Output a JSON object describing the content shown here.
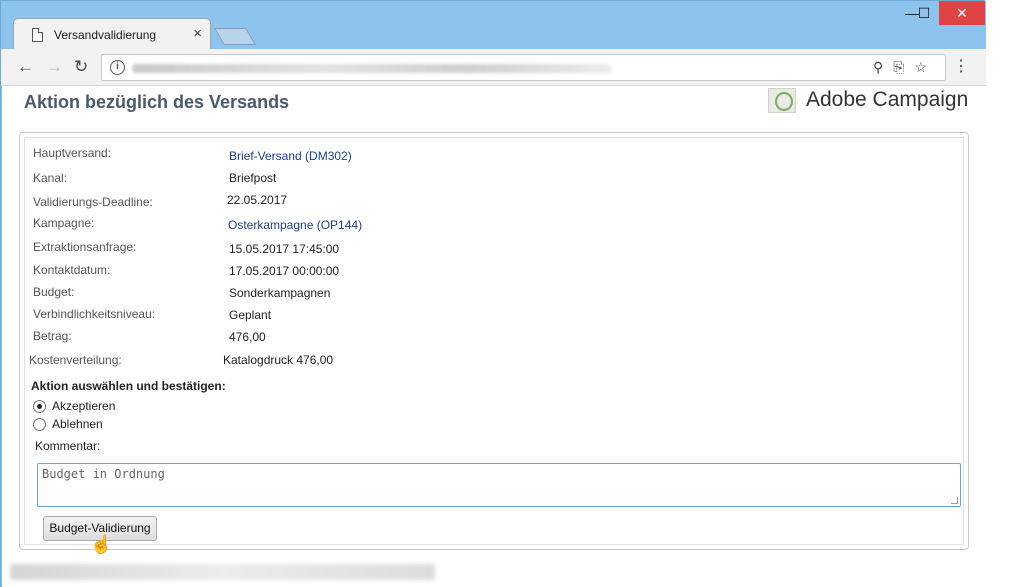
{
  "browser": {
    "tab_title": "Versandvalidierung",
    "tab_close": "×",
    "win_minimize": "—",
    "win_maximize": "☐",
    "win_close": "✕",
    "back": "←",
    "forward": "→",
    "reload": "↻",
    "info": "i",
    "omni_icons": "⚲⎘☆",
    "menu": "⋮"
  },
  "page": {
    "title": "Aktion bezüglich des Versands",
    "logo": "Adobe Campaign"
  },
  "details": [
    {
      "label": "Hauptversand:",
      "value": "Brief-Versand (DM302)",
      "link": true
    },
    {
      "label": "Kanal:",
      "value": "Briefpost",
      "link": false
    },
    {
      "label": "Validierungs-Deadline:",
      "value": "22.05.2017",
      "link": false
    },
    {
      "label": "Kampagne:",
      "value": "Osterkampagne (OP144)",
      "link": true
    },
    {
      "label": "Extraktionsanfrage:",
      "value": "15.05.2017 17:45:00",
      "link": false
    },
    {
      "label": "Kontaktdatum:",
      "value": "17.05.2017 00:00:00",
      "link": false
    },
    {
      "label": "Budget:",
      "value": "Sonderkampagnen",
      "link": false
    },
    {
      "label": "Verbindlichkeitsniveau:",
      "value": "Geplant",
      "link": false
    },
    {
      "label": "Betrag:",
      "value": "476,00",
      "link": false
    },
    {
      "label": "Kostenverteilung:",
      "value": "Katalogdruck 476,00",
      "link": false
    }
  ],
  "action": {
    "section_title": "Aktion auswählen und bestätigen:",
    "options": [
      {
        "label": "Akzeptieren",
        "selected": true
      },
      {
        "label": "Ablehnen",
        "selected": false
      }
    ],
    "comment_label": "Kommentar:",
    "comment_value": "Budget in Ordnung",
    "submit_label": "Budget-Validierung"
  }
}
